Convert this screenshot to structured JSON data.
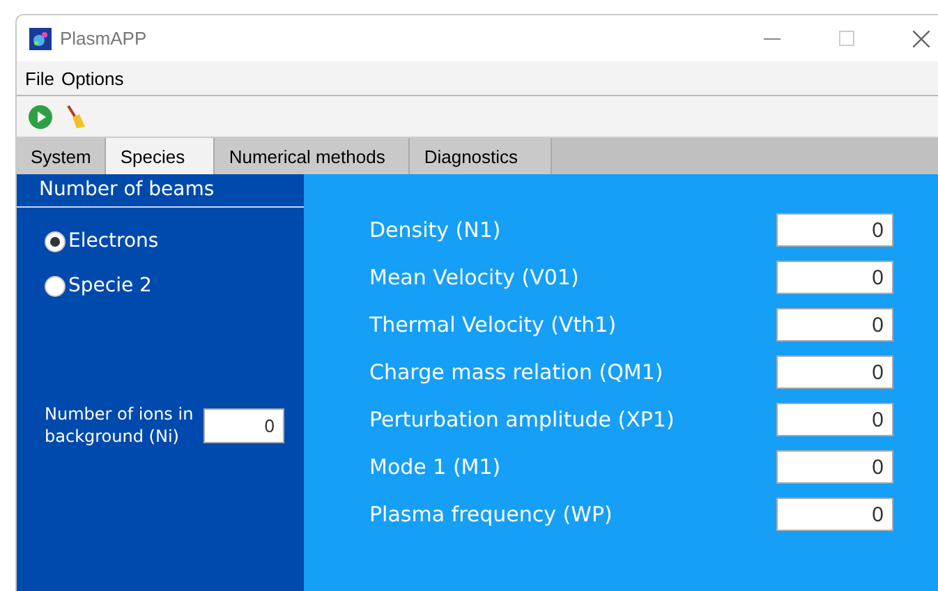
{
  "window": {
    "title": "PlasmAPP"
  },
  "menu": [
    "File",
    "Options"
  ],
  "tabs": [
    {
      "label": "System",
      "selected": false
    },
    {
      "label": "Species",
      "selected": true
    },
    {
      "label": "Numerical methods",
      "selected": false
    },
    {
      "label": "Diagnostics",
      "selected": false
    }
  ],
  "beams": {
    "title": "Number of beams",
    "options": [
      {
        "label": "Electrons",
        "selected": true
      },
      {
        "label": "Specie 2",
        "selected": false
      }
    ],
    "ions": {
      "label": "Number of ions in background (Ni)",
      "value": "0"
    }
  },
  "parameters": [
    {
      "label": "Density (N1)",
      "value": "0"
    },
    {
      "label": "Mean Velocity (V01)",
      "value": "0"
    },
    {
      "label": "Thermal Velocity (Vth1)",
      "value": "0"
    },
    {
      "label": "Charge mass relation (QM1)",
      "value": "0"
    },
    {
      "label": "Perturbation amplitude (XP1)",
      "value": "0"
    },
    {
      "label": "Mode 1 (M1)",
      "value": "0"
    },
    {
      "label": "Plasma frequency (WP)",
      "value": "0"
    }
  ]
}
